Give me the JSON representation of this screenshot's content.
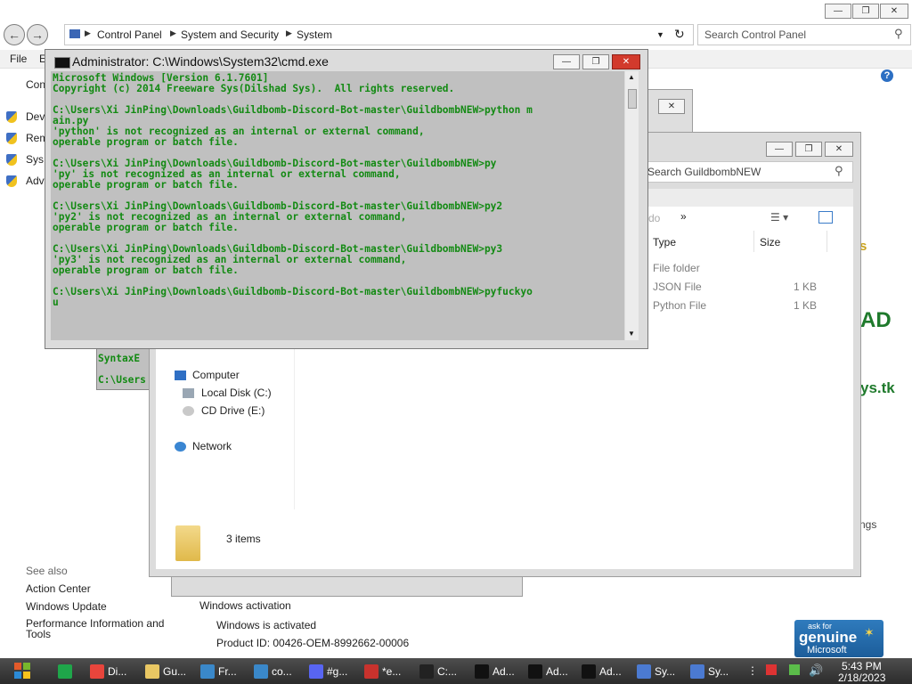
{
  "control_panel": {
    "breadcrumbs": [
      "Control Panel",
      "System and Security",
      "System"
    ],
    "search_placeholder": "Search Control Panel",
    "menu": [
      "File",
      "E"
    ],
    "left_label": "Con",
    "left_items": [
      "Dev",
      "Rem",
      "Sys",
      "Adv"
    ],
    "see_also": {
      "heading": "See also",
      "links": [
        "Action Center",
        "Windows Update",
        "Performance Information and Tools"
      ]
    },
    "activation": {
      "heading": "Windows activation",
      "status": "Windows is activated",
      "product_id": "Product ID: 00426-OEM-8992662-00006",
      "badge_top": "ask for",
      "badge_main": "genuine",
      "badge_brand": "Microsoft"
    },
    "edge_fragments": {
      "s": "s",
      "ad": "AD",
      "ys_tk": "ys.tk",
      "ngs": "ngs"
    }
  },
  "behind_window": {
    "fragments": [
      "SyntaxE",
      "C:\\Users"
    ]
  },
  "explorer": {
    "search_placeholder": "Search GuildbombNEW",
    "toolbar_fragment": "do",
    "columns": [
      "Type",
      "Size"
    ],
    "files": [
      {
        "type": "File folder",
        "size": ""
      },
      {
        "type": "JSON File",
        "size": "1 KB"
      },
      {
        "type": "Python File",
        "size": "1 KB"
      }
    ],
    "nav": {
      "computer": "Computer",
      "local_disk": "Local Disk (C:)",
      "cd_drive": "CD Drive (E:)",
      "network": "Network"
    },
    "status": "3 items"
  },
  "cmd": {
    "title": "Administrator: C:\\Windows\\System32\\cmd.exe",
    "lines": [
      "Microsoft Windows [Version 6.1.7601]",
      "Copyright (c) 2014 Freeware Sys(Dilshad Sys).  All rights reserved.",
      "",
      "C:\\Users\\Xi JinPing\\Downloads\\Guildbomb-Discord-Bot-master\\GuildbombNEW>python m",
      "ain.py",
      "'python' is not recognized as an internal or external command,",
      "operable program or batch file.",
      "",
      "C:\\Users\\Xi JinPing\\Downloads\\Guildbomb-Discord-Bot-master\\GuildbombNEW>py",
      "'py' is not recognized as an internal or external command,",
      "operable program or batch file.",
      "",
      "C:\\Users\\Xi JinPing\\Downloads\\Guildbomb-Discord-Bot-master\\GuildbombNEW>py2",
      "'py2' is not recognized as an internal or external command,",
      "operable program or batch file.",
      "",
      "C:\\Users\\Xi JinPing\\Downloads\\Guildbomb-Discord-Bot-master\\GuildbombNEW>py3",
      "'py3' is not recognized as an internal or external command,",
      "operable program or batch file.",
      "",
      "C:\\Users\\Xi JinPing\\Downloads\\Guildbomb-Discord-Bot-master\\GuildbombNEW>pyfuckyo",
      "u"
    ]
  },
  "taskbar": {
    "items": [
      {
        "label": "",
        "icon": "green-app-icon",
        "color": "#1fa64a"
      },
      {
        "label": "Di...",
        "icon": "chrome-icon",
        "color": "#e8453c"
      },
      {
        "label": "Gu...",
        "icon": "folder-icon",
        "color": "#e9c763"
      },
      {
        "label": "Fr...",
        "icon": "editor-icon",
        "color": "#3a88c9"
      },
      {
        "label": "co...",
        "icon": "editor-icon",
        "color": "#3a88c9"
      },
      {
        "label": "#g...",
        "icon": "discord-icon",
        "color": "#5865f2"
      },
      {
        "label": "*e...",
        "icon": "notepad-icon",
        "color": "#c8322d"
      },
      {
        "label": "C:...",
        "icon": "7zip-icon",
        "color": "#222222"
      },
      {
        "label": "Ad...",
        "icon": "cmd-icon",
        "color": "#111111"
      },
      {
        "label": "Ad...",
        "icon": "cmd-icon",
        "color": "#111111"
      },
      {
        "label": "Ad...",
        "icon": "cmd-icon",
        "color": "#111111"
      },
      {
        "label": "Sy...",
        "icon": "system-icon",
        "color": "#4b7ad1"
      },
      {
        "label": "Sy...",
        "icon": "system-icon",
        "color": "#4b7ad1"
      }
    ],
    "time": "5:43 PM",
    "date": "2/18/2023"
  },
  "colors": {
    "console_bg": "#c0c0c0",
    "console_text": "#138a13",
    "taskbar": "#333333",
    "close_button": "#d23a2c"
  }
}
